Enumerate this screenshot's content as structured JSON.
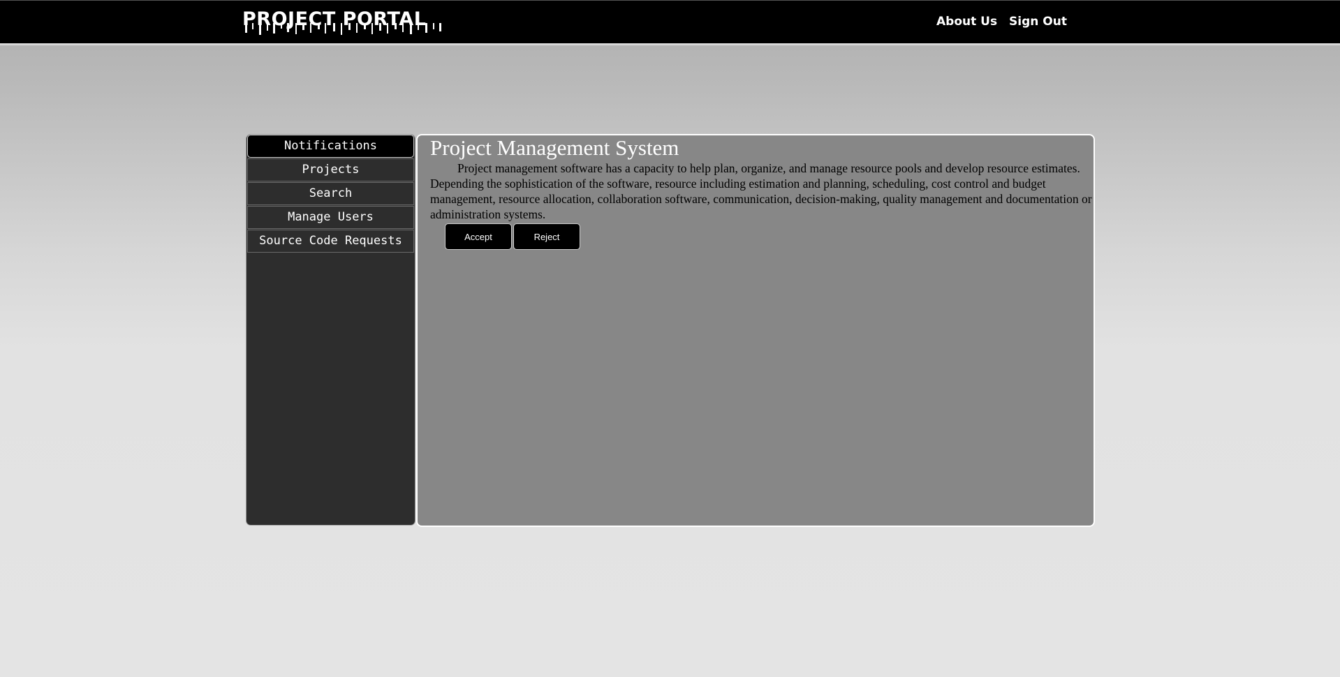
{
  "header": {
    "logo_text": "PROJECT PORTAL",
    "nav": {
      "about_label": "About Us",
      "signout_label": "Sign Out"
    }
  },
  "sidebar": {
    "items": [
      {
        "label": "Notifications",
        "active": true
      },
      {
        "label": "Projects",
        "active": false
      },
      {
        "label": "Search",
        "active": false
      },
      {
        "label": "Manage Users",
        "active": false
      },
      {
        "label": "Source Code Requests",
        "active": false
      }
    ]
  },
  "main": {
    "title": "Project Management System",
    "description": "Project management software has a capacity to help plan, organize, and manage resource pools and develop resource estimates. Depending the sophistication of the software, resource including estimation and planning, scheduling, cost control and budget management, resource allocation, collaboration software, communication, decision-making, quality management and documentation or administration systems.",
    "accept_label": "Accept",
    "reject_label": "Reject"
  },
  "colors": {
    "header_bg": "#000000",
    "sidebar_bg": "#2d2d2d",
    "content_bg": "#878787",
    "button_bg": "#000000"
  }
}
